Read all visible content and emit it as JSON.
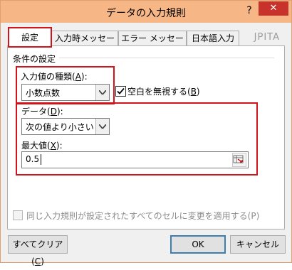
{
  "window": {
    "title": "データの入力規則",
    "help_label": "?",
    "close_label": "✕"
  },
  "tabs": [
    {
      "label": "設定",
      "active": true
    },
    {
      "label": "入力時メッセージ",
      "active": false
    },
    {
      "label": "エラー メッセージ",
      "active": false
    },
    {
      "label": "日本語入力",
      "active": false
    }
  ],
  "watermark": "JPITA",
  "conditions": {
    "group_label": "条件の設定",
    "allow_label": "入力値の種類(",
    "allow_key": "A",
    "allow_suffix": "):",
    "allow_value": "小数点数",
    "ignore_blank_label": "空白を無視する(",
    "ignore_blank_key": "B",
    "ignore_blank_suffix": ")",
    "ignore_blank_checked": true,
    "data_label": "データ(",
    "data_key": "D",
    "data_suffix": "):",
    "data_value": "次の値より小さい",
    "max_label": "最大値(",
    "max_key": "X",
    "max_suffix": "):",
    "max_value": "0.5"
  },
  "apply_all": {
    "label": "同じ入力規則が設定されたすべてのセルに変更を適用する(P)",
    "enabled": false
  },
  "buttons": {
    "clear_label": "すべてクリア(",
    "clear_key": "C",
    "clear_suffix": ")",
    "ok_label": "OK",
    "cancel_label": "キャンセル"
  },
  "colors": {
    "titlebar": "#f7b686",
    "close": "#c7332b",
    "highlight": "#d2141a"
  }
}
